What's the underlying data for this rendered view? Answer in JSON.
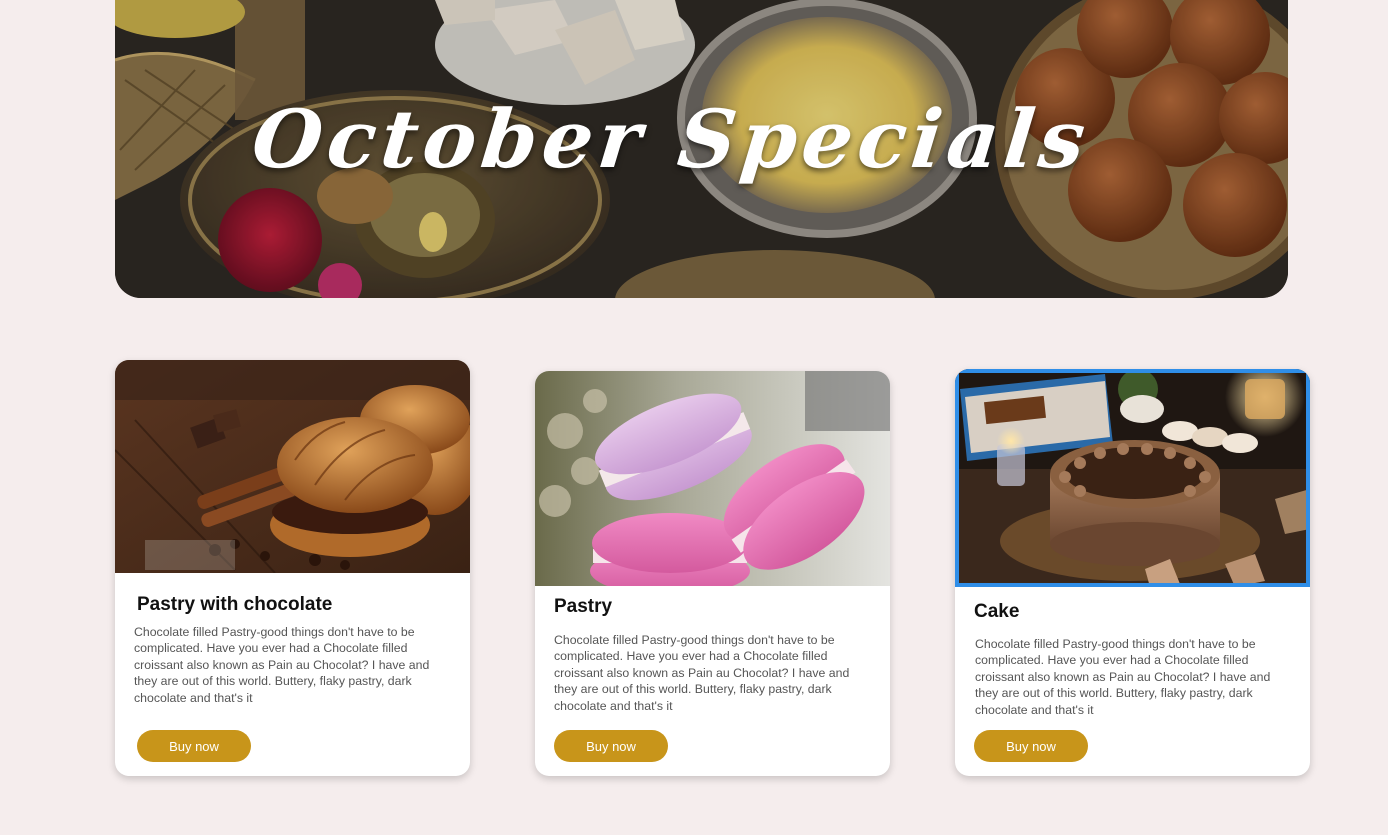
{
  "hero": {
    "title": "October Specials"
  },
  "products": [
    {
      "title": "Pastry with chocolate",
      "description": "Chocolate filled Pastry-good things don't have to be complicated. Have you ever had a Chocolate filled croissant also known as Pain au Chocolat? I have and they are out of this world. Buttery, flaky pastry, dark chocolate and that's it",
      "button_label": "Buy now"
    },
    {
      "title": "Pastry",
      "description": "Chocolate filled Pastry-good things don't have to be complicated. Have you ever had a Chocolate filled croissant also known as Pain au Chocolat? I have and they are out of this world. Buttery, flaky pastry, dark chocolate and that's it",
      "button_label": "Buy now"
    },
    {
      "title": "Cake",
      "description": "Chocolate filled Pastry-good things don't have to be complicated. Have you ever had a Chocolate filled croissant also known as Pain au Chocolat? I have and they are out of this world. Buttery, flaky pastry, dark chocolate and that's it",
      "button_label": "Buy now"
    }
  ],
  "colors": {
    "page_background": "#f5eded",
    "button": "#c8951a",
    "selected_outline": "#2f8ee8"
  }
}
